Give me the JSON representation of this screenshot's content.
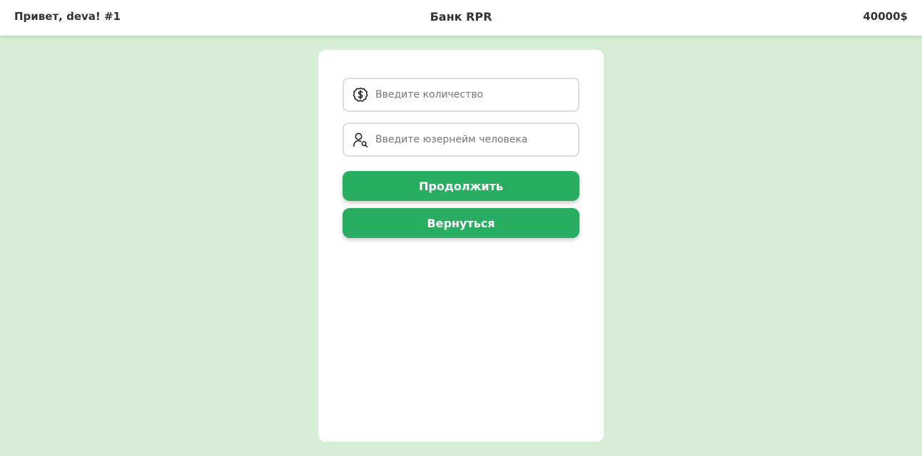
{
  "header": {
    "greeting": "Привет, deva! #1",
    "title": "Банк RPR",
    "balance": "40000$"
  },
  "form": {
    "amount": {
      "icon": "dollar-coin-icon",
      "placeholder": "Введите количество",
      "value": ""
    },
    "username": {
      "icon": "user-search-icon",
      "placeholder": "Введите юзернейм человека",
      "value": ""
    },
    "continue_label": "Продолжить",
    "back_label": "Вернуться"
  },
  "colors": {
    "page_background": "#d5efd6",
    "button": "#27ae60",
    "card": "#ffffff"
  }
}
